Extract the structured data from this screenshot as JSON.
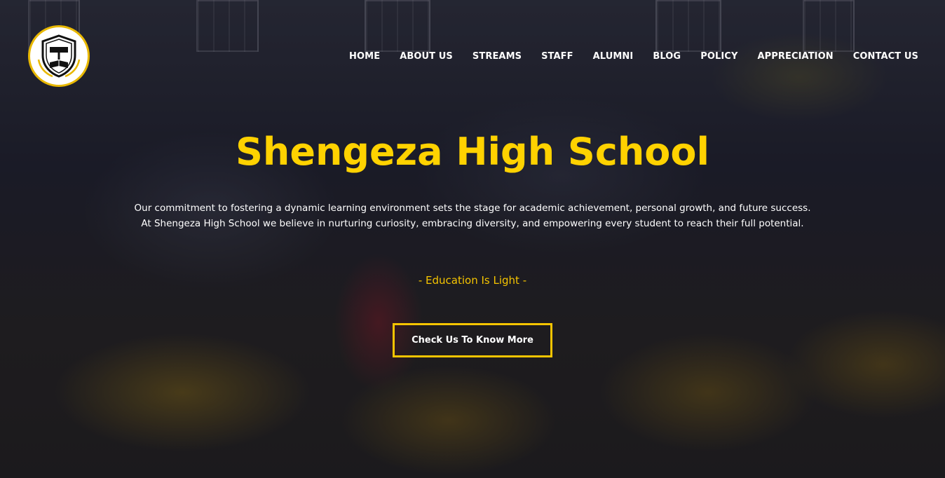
{
  "header": {
    "logo_icon": "school-crest-icon",
    "nav": [
      {
        "label": "HOME"
      },
      {
        "label": "ABOUT US"
      },
      {
        "label": "STREAMS"
      },
      {
        "label": "STAFF"
      },
      {
        "label": "ALUMNI"
      },
      {
        "label": "BLOG"
      },
      {
        "label": "POLICY"
      },
      {
        "label": "APPRECIATION"
      },
      {
        "label": "CONTACT US"
      }
    ]
  },
  "hero": {
    "title": "Shengeza High School",
    "description_line1": "Our commitment to fostering a dynamic learning environment sets the stage for academic achievement, personal growth, and future success.",
    "description_line2": "At Shengeza High School we believe in nurturing curiosity, embracing diversity, and empowering every student to reach their full potential.",
    "motto": "- Education Is Light -",
    "cta_label": "Check Us To Know More"
  },
  "colors": {
    "accent": "#ffd200",
    "text": "#ffffff"
  }
}
